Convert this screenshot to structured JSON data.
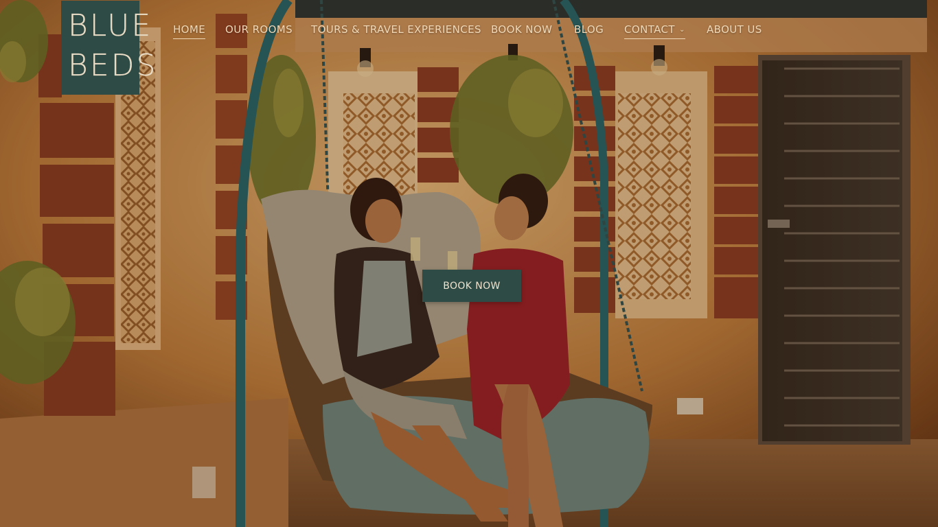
{
  "brand": {
    "logo_line1": "BLUE",
    "logo_line2": "BEDS",
    "logo_color": "#2e4b45"
  },
  "nav": {
    "items": [
      {
        "label": "HOME",
        "active": true
      },
      {
        "label": "OUR ROOMS"
      },
      {
        "label": "TOURS & TRAVEL EXPERIENCES"
      },
      {
        "label": "BOOK NOW"
      },
      {
        "label": "BLOG"
      },
      {
        "label": "CONTACT",
        "has_dropdown": true,
        "dropdown_icon": "chevron-down-icon"
      },
      {
        "label": "ABOUT US"
      }
    ]
  },
  "hero": {
    "cta_label": "BOOK NOW",
    "cta_color": "#2e4b45",
    "image": "two-women-on-swing-chair-toasting"
  },
  "colors": {
    "nav_text": "#f0d9b8",
    "wall_warm": "#d99a5a",
    "swing_frame": "#1f6a72"
  }
}
